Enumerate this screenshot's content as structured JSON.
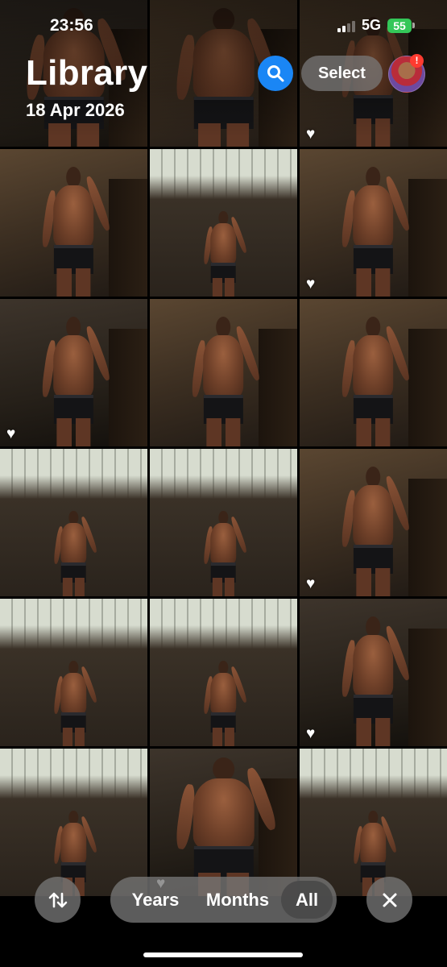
{
  "status_bar": {
    "time": "23:56",
    "network": "5G",
    "battery": "55"
  },
  "header": {
    "title": "Library",
    "date": "18 Apr 2026",
    "search_icon": "magnifying-glass-icon",
    "select_label": "Select",
    "avatar_badge": "!"
  },
  "photos": [
    {
      "style": "dark",
      "figure": "large",
      "favorite": false
    },
    {
      "style": "warm",
      "figure": "large",
      "favorite": false
    },
    {
      "style": "warm",
      "figure": "normal",
      "favorite": true
    },
    {
      "style": "warm",
      "figure": "normal",
      "favorite": false
    },
    {
      "style": "window",
      "figure": "small",
      "favorite": false
    },
    {
      "style": "warm",
      "figure": "normal",
      "favorite": true
    },
    {
      "style": "dark",
      "figure": "normal",
      "favorite": true
    },
    {
      "style": "warm",
      "figure": "normal",
      "favorite": false
    },
    {
      "style": "warm",
      "figure": "normal",
      "favorite": false
    },
    {
      "style": "window",
      "figure": "small",
      "favorite": false
    },
    {
      "style": "window",
      "figure": "small",
      "favorite": false
    },
    {
      "style": "warm",
      "figure": "normal",
      "favorite": true
    },
    {
      "style": "window",
      "figure": "small",
      "favorite": false
    },
    {
      "style": "window",
      "figure": "small",
      "favorite": false
    },
    {
      "style": "dark",
      "figure": "normal",
      "favorite": true
    },
    {
      "style": "window",
      "figure": "small",
      "favorite": false
    },
    {
      "style": "dark",
      "figure": "large",
      "favorite": true
    },
    {
      "style": "window",
      "figure": "small",
      "favorite": false
    }
  ],
  "bottom_bar": {
    "sort_icon": "up-down-arrows-icon",
    "segments": [
      "Years",
      "Months",
      "All"
    ],
    "selected_segment": "All",
    "close_icon": "close-icon"
  },
  "colors": {
    "accent": "#1a86f5",
    "battery": "#34c759",
    "badge": "#ff3b30"
  }
}
